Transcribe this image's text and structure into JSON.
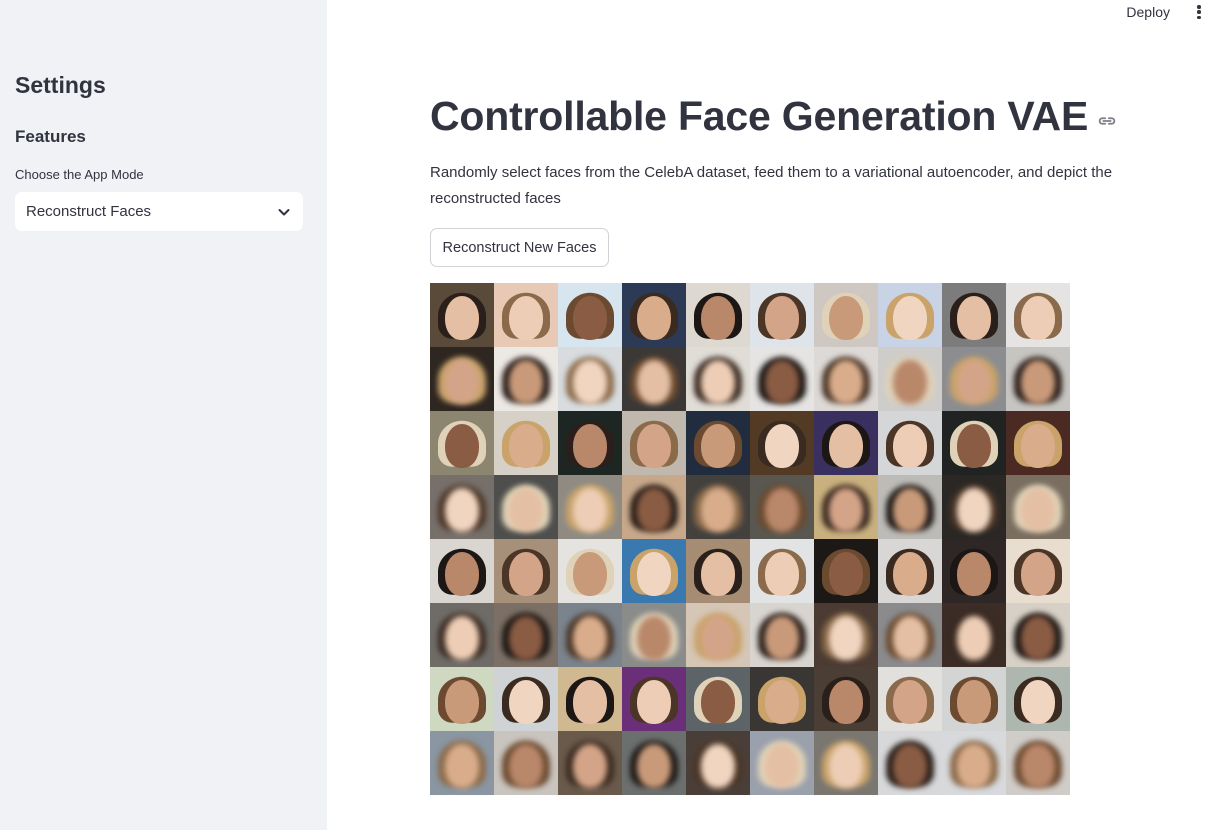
{
  "sidebar": {
    "title": "Settings",
    "subtitle": "Features",
    "select_label": "Choose the App Mode",
    "select_value": "Reconstruct Faces"
  },
  "header": {
    "deploy_label": "Deploy",
    "menu_icon": "kebab-menu-icon"
  },
  "main": {
    "title": "Controllable Face Generation VAE",
    "title_link_icon": "link-icon",
    "description": "Randomly select faces from the CelebA dataset, feed them to a variational autoencoder, and depict the reconstructed faces",
    "button_label": "Reconstruct New Faces"
  },
  "colors": {
    "sidebar_bg": "#f0f2f6",
    "text": "#31333f",
    "button_border": "#d0d2d8"
  },
  "face_grid": {
    "rows": 8,
    "cols": 10,
    "row_types": [
      "original",
      "reconstructed",
      "original",
      "reconstructed",
      "original",
      "reconstructed",
      "original",
      "reconstructed"
    ],
    "cells": [
      [
        "#5a4a3a",
        "#e7c9b5",
        "#d7e6ee",
        "#2d3a55",
        "#ddd8d0",
        "#dfe4ea",
        "#cfc8c2",
        "#c9d3e6",
        "#7c7c7c",
        "#e6e4e2"
      ],
      [
        "#2e2620",
        "#ece8e4",
        "#d8dcdf",
        "#3b3836",
        "#e0dcd6",
        "#e5e4e2",
        "#ddd9d6",
        "#cfcdca",
        "#8c8d90",
        "#c7c5c2"
      ],
      [
        "#8c8670",
        "#d7d0c6",
        "#1d2622",
        "#c0b8ad",
        "#212c3e",
        "#523a25",
        "#3a3060",
        "#d5d6d8",
        "#202321",
        "#4a2a22"
      ],
      [
        "#776f6a",
        "#4e4e4c",
        "#8f8b83",
        "#c8a88a",
        "#43403d",
        "#5a5751",
        "#c9b07f",
        "#bdbbb7",
        "#2a2725",
        "#7a6e60"
      ],
      [
        "#d9d6d1",
        "#a6907a",
        "#e5e3e0",
        "#3a78b0",
        "#a58c73",
        "#e1e3e4",
        "#1c1816",
        "#d8d7d6",
        "#2e2725",
        "#e9ddd0"
      ],
      [
        "#6f6c68",
        "#7c7066",
        "#7b838c",
        "#8a8c8a",
        "#d6c6b6",
        "#d8d4cf",
        "#4b3b33",
        "#8b8b8d",
        "#3b2c26",
        "#d7d0c6"
      ],
      [
        "#cfd8c0",
        "#cfd3d6",
        "#d0b890",
        "#6a2f78",
        "#5c6468",
        "#3a3634",
        "#4b3f35",
        "#e2e0dc",
        "#d3d4d4",
        "#aeb6b0"
      ],
      [
        "#8a96a2",
        "#c9c4be",
        "#6a5a4c",
        "#6b6f6e",
        "#4a3f38",
        "#9aa0ac",
        "#7a7670",
        "#d7d8da",
        "#d7d9dc",
        "#d0ccc8"
      ]
    ]
  }
}
